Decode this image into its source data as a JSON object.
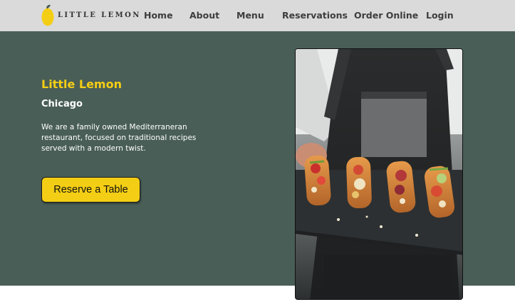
{
  "brand": {
    "logo_text": "LITTLE LEMON"
  },
  "nav": {
    "items": [
      {
        "label": "Home"
      },
      {
        "label": "About"
      },
      {
        "label": "Menu"
      },
      {
        "label": "Reservations"
      },
      {
        "label": "Order Online"
      },
      {
        "label": "Login"
      }
    ]
  },
  "hero": {
    "title": "Little Lemon",
    "city": "Chicago",
    "description": "We are a family owned Mediterraneran restaurant, focused on traditional recipes served with a modern twist.",
    "cta_label": "Reserve a Table"
  },
  "colors": {
    "primary_green": "#495e57",
    "primary_yellow": "#f4ce14",
    "nav_background": "#dadada"
  }
}
